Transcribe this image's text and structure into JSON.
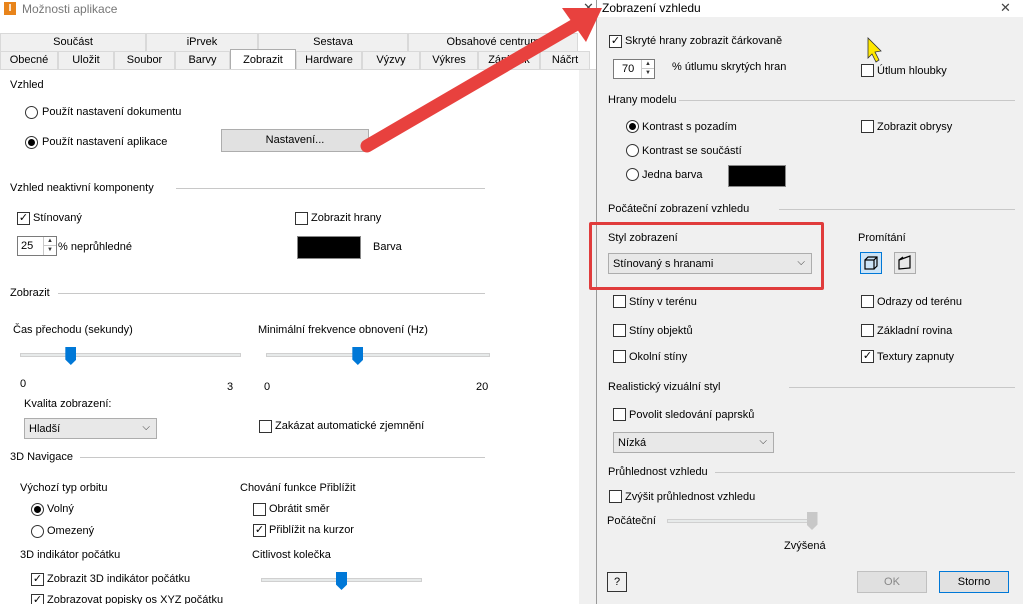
{
  "left": {
    "title": "Možnosti aplikace",
    "tabs_row1": [
      "Součást",
      "iPrvek",
      "Sestava",
      "Obsahové centrum"
    ],
    "tabs_row2": [
      "Obecné",
      "Uložit",
      "Soubor",
      "Barvy",
      "Zobrazit",
      "Hardware",
      "Výzvy",
      "Výkres",
      "Zápisník",
      "Náčrt"
    ],
    "appearance": {
      "label": "Vzhled",
      "radio_doc": "Použít nastavení dokumentu",
      "radio_app": "Použít nastavení aplikace",
      "settings_button": "Nastavení..."
    },
    "inactive": {
      "label": "Vzhled neaktivní komponenty",
      "shaded": "Stínovaný",
      "show_edges": "Zobrazit hrany",
      "opacity_value": "25",
      "opacity_label": "% neprůhledné",
      "color_label": "Barva"
    },
    "display": {
      "label": "Zobrazit",
      "transition_label": "Čas přechodu (sekundy)",
      "transition_min": "0",
      "transition_max": "3",
      "transition_value": 0.23,
      "min_rate_label": "Minimální frekvence obnovení (Hz)",
      "min_rate_min": "0",
      "min_rate_max": "20",
      "min_rate_value": 0.41,
      "quality_label": "Kvalita zobrazení:",
      "quality_value": "Hladší",
      "disable_auto_label": "Zakázat automatické zjemnění"
    },
    "nav3d": {
      "label": "3D Navigace",
      "orbit_label": "Výchozí typ orbitu",
      "orbit_free": "Volný",
      "orbit_constrained": "Omezený",
      "zoom_label": "Chování funkce Přiblížit",
      "zoom_reverse": "Obrátit směr",
      "zoom_cursor": "Přiblížit na kurzor",
      "origin_label": "3D indikátor počátku",
      "origin_show": "Zobrazit 3D indikátor počátku",
      "origin_xyz": "Zobrazovat popisky os XYZ počátku",
      "wheel_label": "Citlivost kolečka",
      "wheel_value": 0.5
    }
  },
  "right": {
    "title": "Zobrazení vzhledu",
    "hidden_dashed": "Skryté hrany zobrazit čárkovaně",
    "dim_value": "70",
    "dim_label": "% útlumu skrytých hran",
    "depth_dim": "Útlum hloubky",
    "model_edges": {
      "label": "Hrany modelu",
      "contrast_bg": "Kontrast s pozadím",
      "contrast_part": "Kontrast se součástí",
      "single_color": "Jedna barva",
      "show_silhouettes": "Zobrazit obrysy"
    },
    "initial": {
      "label": "Počáteční zobrazení vzhledu",
      "style_label": "Styl zobrazení",
      "style_value": "Stínovaný s hranami",
      "projection_label": "Promítání",
      "ground_shadows": "Stíny v terénu",
      "object_shadows": "Stíny objektů",
      "ambient_shadows": "Okolní stíny",
      "ground_reflections": "Odrazy od terénu",
      "ground_plane": "Základní rovina",
      "textures_on": "Textury zapnuty"
    },
    "realistic": {
      "label": "Realistický vizuální styl",
      "ray_tracing": "Povolit sledování paprsků",
      "quality_value": "Nízká"
    },
    "transparency": {
      "label": "Průhlednost vzhledu",
      "increase": "Zvýšit průhlednost vzhledu",
      "start_label": "Počáteční",
      "end_label": "Zvýšená",
      "value": 1.0
    },
    "ok_label": "OK",
    "cancel_label": "Storno",
    "help_label": "?"
  },
  "colors": {
    "accent": "#0078d7",
    "annotation_red": "#e8413e",
    "cursor_yellow": "#ffe800"
  }
}
